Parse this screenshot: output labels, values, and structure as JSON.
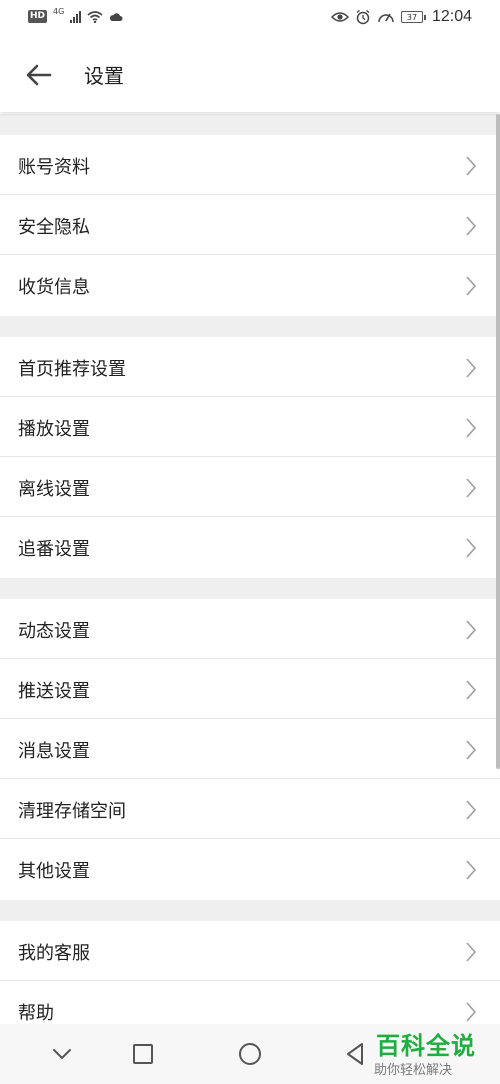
{
  "status_bar": {
    "hd": "HD",
    "network": "4G",
    "battery": "37",
    "time": "12:04"
  },
  "header": {
    "title": "设置"
  },
  "settings": {
    "groups": [
      {
        "items": [
          {
            "label": "账号资料"
          },
          {
            "label": "安全隐私"
          },
          {
            "label": "收货信息"
          }
        ]
      },
      {
        "items": [
          {
            "label": "首页推荐设置"
          },
          {
            "label": "播放设置"
          },
          {
            "label": "离线设置"
          },
          {
            "label": "追番设置"
          }
        ]
      },
      {
        "items": [
          {
            "label": "动态设置"
          },
          {
            "label": "推送设置"
          },
          {
            "label": "消息设置"
          },
          {
            "label": "清理存储空间"
          },
          {
            "label": "其他设置"
          }
        ]
      },
      {
        "items": [
          {
            "label": "我的客服"
          },
          {
            "label": "帮助"
          }
        ]
      }
    ]
  },
  "watermark": {
    "title": "百科全说",
    "subtitle": "助你轻松解决"
  },
  "colors": {
    "background": "#f0f0f0",
    "watermark_green": "#1fae3f"
  },
  "icons": {
    "back": "arrow-left",
    "chevron": "chevron-right",
    "nav": [
      "chevron-down",
      "square",
      "circle",
      "triangle-left"
    ]
  }
}
